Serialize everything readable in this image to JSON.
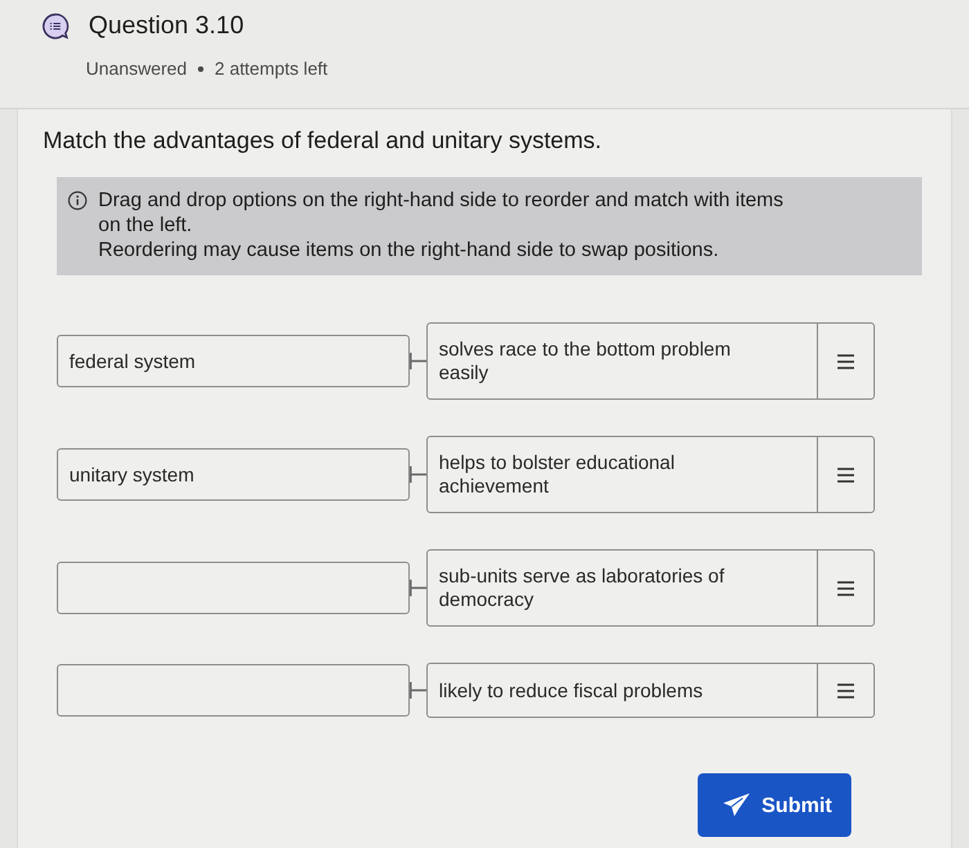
{
  "header": {
    "title": "Question 3.10",
    "status": "Unanswered",
    "attempts": "2 attempts left"
  },
  "prompt": "Match the advantages of federal and unitary systems.",
  "instructions": [
    "Drag and drop options on the right-hand side to reorder and match with items on the left.",
    "Reordering may cause items on the right-hand side to swap positions."
  ],
  "pairs": [
    {
      "target": "federal system",
      "option": "solves race to the bottom problem easily"
    },
    {
      "target": "unitary system",
      "option": "helps to bolster educational achievement"
    },
    {
      "option": "sub-units serve as laboratories of democracy"
    },
    {
      "option": "likely to reduce fiscal problems"
    }
  ],
  "submit": {
    "label": "Submit"
  }
}
